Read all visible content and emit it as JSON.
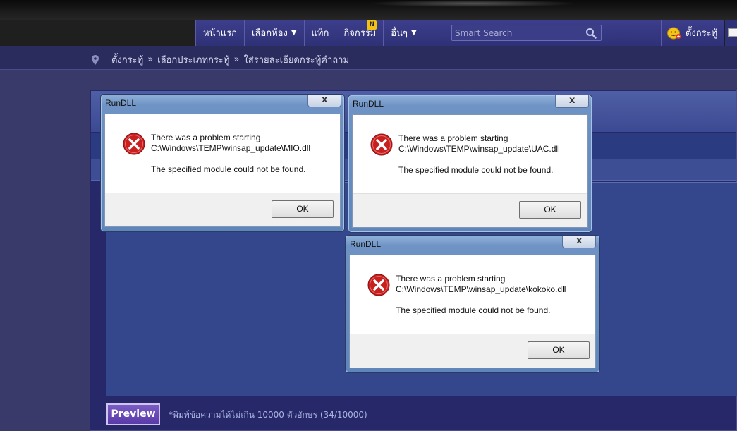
{
  "nav": {
    "items": [
      {
        "label": "หน้าแรก",
        "caret": ""
      },
      {
        "label": "เลือกห้อง",
        "caret": "▼"
      },
      {
        "label": "แท็ก",
        "caret": ""
      },
      {
        "label": "กิจกรรม",
        "caret": "",
        "badge": "N"
      },
      {
        "label": "อื่นๆ",
        "caret": "▼"
      }
    ],
    "search_placeholder": "Smart Search",
    "user_label": "ตั้งกระทู้"
  },
  "breadcrumb": {
    "items": [
      "ตั้งกระทู้",
      "เลือกประเภทกระทู้",
      "ใส่รายละเอียดกระทู้คำถาม"
    ],
    "separator": "»"
  },
  "editor": {
    "preview_label": "Preview",
    "counter_text": "*พิมพ์ข้อความได้ไม่เกิน 10000 ตัวอักษร (34/10000)"
  },
  "dialogs": [
    {
      "title": "RunDLL",
      "close": "x",
      "line1": "There was a problem starting",
      "line2": "C:\\Windows\\TEMP\\winsap_update\\MIO.dll",
      "line3": "The specified module could not be found.",
      "ok": "OK"
    },
    {
      "title": "RunDLL",
      "close": "x",
      "line1": "There was a problem starting",
      "line2": "C:\\Windows\\TEMP\\winsap_update\\UAC.dll",
      "line3": "The specified module could not be found.",
      "ok": "OK"
    },
    {
      "title": "RunDLL",
      "close": "x",
      "line1": "There was a problem starting",
      "line2": "C:\\Windows\\TEMP\\winsap_update\\kokoko.dll",
      "line3": "The specified module could not be found.",
      "ok": "OK"
    }
  ],
  "colors": {
    "nav_bg": "#3c3e8c",
    "page_bg": "#39396a",
    "preview_btn": "#6a4cb8",
    "badge": "#f3c312",
    "error_red": "#c8201f"
  }
}
